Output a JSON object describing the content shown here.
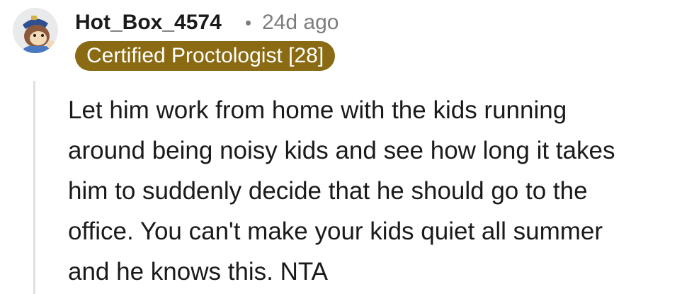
{
  "comment": {
    "username": "Hot_Box_4574",
    "separator": "•",
    "age": "24d ago",
    "flair": "Certified Proctologist [28]",
    "body_lines": [
      "Let him work from home with the kids running",
      "around being noisy kids and see how long it takes",
      "him to suddenly decide that he should go to the",
      "office. You can't make your kids quiet all summer",
      "and he knows this. NTA"
    ]
  },
  "colors": {
    "flair_background": "#8a6a12",
    "flair_text": "#ffffff",
    "username": "#1a1a1b",
    "meta": "#7c7c7c",
    "thread_line": "#e0e0e0"
  },
  "icons": {
    "avatar": "avatar-icon"
  }
}
